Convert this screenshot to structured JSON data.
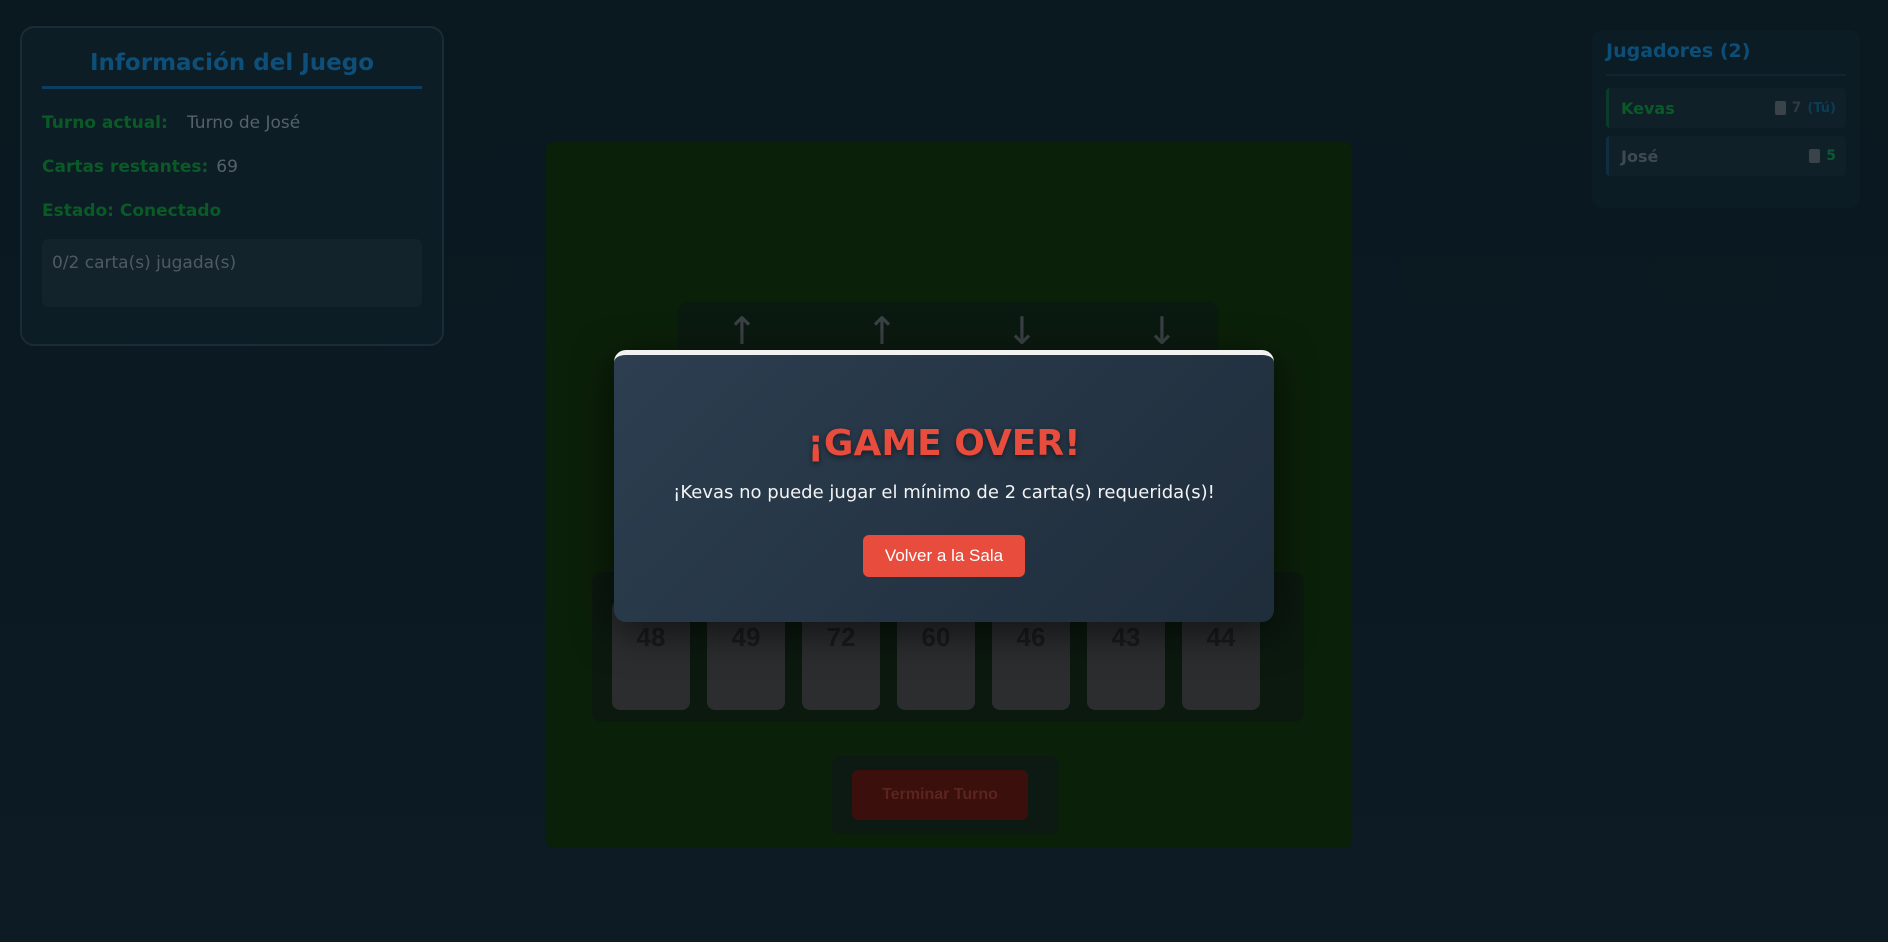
{
  "info": {
    "title": "Información del Juego",
    "turn_label": "Turno actual:",
    "turn_value": "Turno de José",
    "cards_label": "Cartas restantes:",
    "cards_value": "69",
    "status": "Estado: Conectado",
    "played": "0/2 carta(s) jugada(s)"
  },
  "players": {
    "title": "Jugadores (2)",
    "list": [
      {
        "name": "Kevas",
        "count": "7",
        "tag": "(Tú)"
      },
      {
        "name": "José",
        "count": "5"
      }
    ]
  },
  "board": {
    "piles": [
      {
        "arrow": "↑",
        "direction": "up"
      },
      {
        "arrow": "↑",
        "direction": "up"
      },
      {
        "arrow": "↓",
        "direction": "down"
      },
      {
        "arrow": "↓",
        "direction": "down"
      }
    ],
    "hand": [
      "48",
      "49",
      "72",
      "60",
      "46",
      "43",
      "44"
    ],
    "end_turn_label": "Terminar Turno"
  },
  "modal": {
    "title": "¡GAME OVER!",
    "message": "¡Kevas no puede jugar el mínimo de 2 carta(s) requerida(s)!",
    "button_label": "Volver a la Sala"
  },
  "colors": {
    "accent_red": "#e74c3c",
    "modal_bg": "#2c3e50",
    "info_title_blue": "#0d4f79",
    "label_green": "#0a5a27"
  }
}
